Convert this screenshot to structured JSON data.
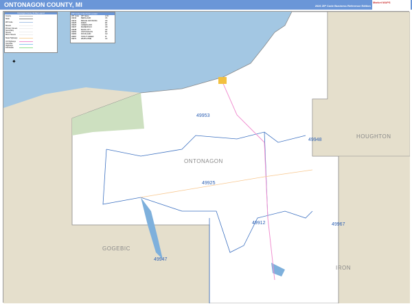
{
  "header": {
    "title": "ONTONAGON COUNTY, MI",
    "edition": "2026 ZIP Code Business Reference Edition",
    "logo": "Market MAPS"
  },
  "legend": {
    "title": "Ontonagon County, Mi Map Legend",
    "items": [
      "County",
      "State",
      "ZIP Code",
      "Streets",
      "Primary Streets",
      "Secondary Streets",
      "Minor Streets",
      "State Highways",
      "US Highways",
      "Interstate Highways",
      "Toll Roads"
    ],
    "colors": [
      "#bbbbbb",
      "#888888",
      "#a8c4e6",
      "#eeeeee",
      "#eeeeee",
      "#eeeeee",
      "#eeeeee",
      "#f8d4a0",
      "#f090d0",
      "#90c8f0",
      "#90e090"
    ]
  },
  "zip_index": {
    "title": "ZIP Code Index/Grid Locator",
    "headers": [
      "ZIP Code",
      "ZIP Name",
      "LOC"
    ],
    "rows": [
      [
        "49910",
        "BERGLAND",
        "C6"
      ],
      [
        "49912",
        "BRUCE CROSSING",
        "G6"
      ],
      [
        "49925",
        "EWEN",
        "E6"
      ],
      [
        "49929",
        "GREENLAND",
        "H3"
      ],
      [
        "49947",
        "MARENISCO",
        "G8"
      ],
      [
        "49948",
        "MASS CITY",
        "H3"
      ],
      [
        "49953",
        "ONTONAGON",
        "E3"
      ],
      [
        "49960",
        "ROCKLAND",
        "G3"
      ],
      [
        "49967",
        "TROUT CREEK",
        "I6"
      ],
      [
        "49971",
        "WHITE PINE",
        "C3"
      ]
    ]
  },
  "map": {
    "zip_labels": [
      "49953",
      "49948",
      "49925",
      "49912",
      "49967",
      "49947"
    ],
    "county_label": "ONTONAGON",
    "neighbors": [
      "HOUGHTON",
      "GOGEBIC",
      "IRON"
    ],
    "colors": {
      "water": "#a3c7e3",
      "land": "#ffffff",
      "neighbor": "#e5dfcc",
      "park": "#cde0c0",
      "zip_border": "#3a6fc0"
    }
  }
}
